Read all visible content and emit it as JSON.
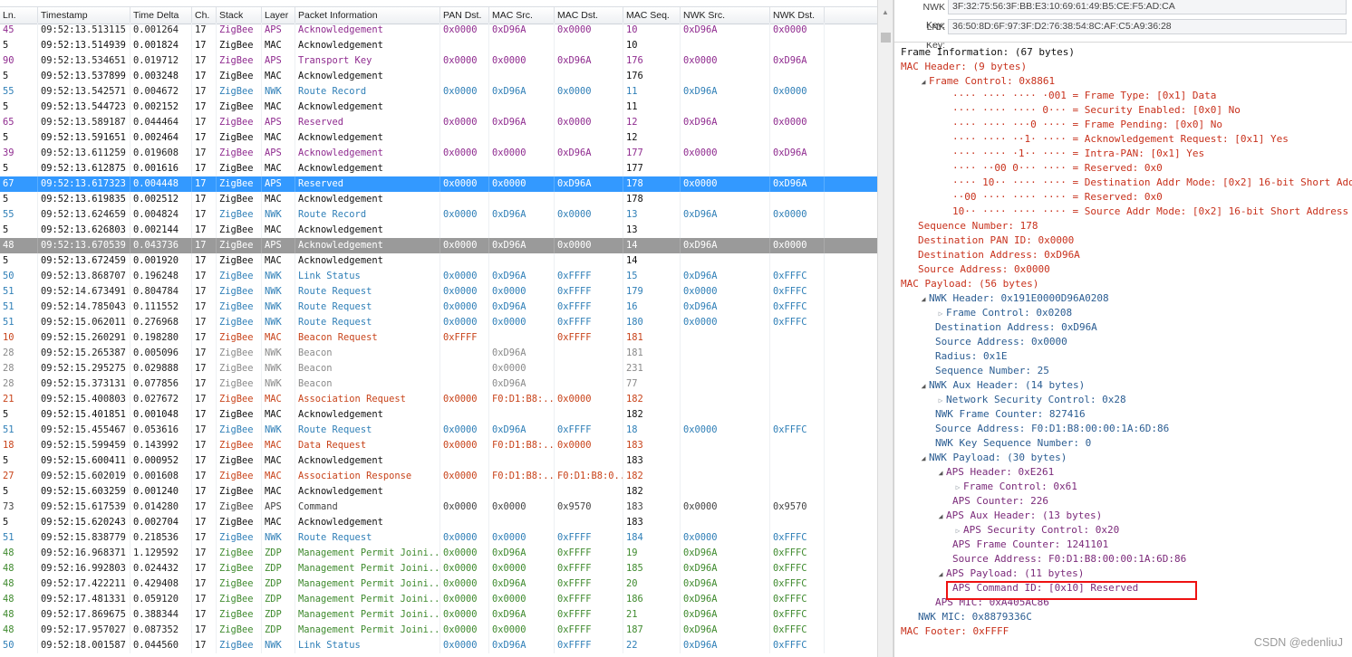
{
  "columns": [
    "Ln.",
    "Timestamp",
    "Time Delta",
    "Ch.",
    "Stack",
    "Layer",
    "Packet Information",
    "PAN Dst.",
    "MAC Src.",
    "MAC Dst.",
    "MAC Seq.",
    "NWK Src.",
    "NWK Dst."
  ],
  "packets": [
    {
      "ln": "45",
      "ts": "09:52:13.513115",
      "delta": "0.001264",
      "ch": "17",
      "stack": "ZigBee",
      "layer": "APS",
      "info": "Acknowledgement",
      "pan": "0x0000",
      "macsrc": "0xD96A",
      "macdst": "0x0000",
      "seq": "10",
      "nwksrc": "0xD96A",
      "nwkdst": "0x0000",
      "color": "#8f2b8f"
    },
    {
      "ln": "5",
      "ts": "09:52:13.514939",
      "delta": "0.001824",
      "ch": "17",
      "stack": "ZigBee",
      "layer": "MAC",
      "info": "Acknowledgement",
      "pan": "",
      "macsrc": "",
      "macdst": "",
      "seq": "10",
      "nwksrc": "",
      "nwkdst": "",
      "color": "#111111"
    },
    {
      "ln": "90",
      "ts": "09:52:13.534651",
      "delta": "0.019712",
      "ch": "17",
      "stack": "ZigBee",
      "layer": "APS",
      "info": "Transport Key",
      "pan": "0x0000",
      "macsrc": "0x0000",
      "macdst": "0xD96A",
      "seq": "176",
      "nwksrc": "0x0000",
      "nwkdst": "0xD96A",
      "color": "#8f2b8f"
    },
    {
      "ln": "5",
      "ts": "09:52:13.537899",
      "delta": "0.003248",
      "ch": "17",
      "stack": "ZigBee",
      "layer": "MAC",
      "info": "Acknowledgement",
      "pan": "",
      "macsrc": "",
      "macdst": "",
      "seq": "176",
      "nwksrc": "",
      "nwkdst": "",
      "color": "#111111"
    },
    {
      "ln": "55",
      "ts": "09:52:13.542571",
      "delta": "0.004672",
      "ch": "17",
      "stack": "ZigBee",
      "layer": "NWK",
      "info": "Route Record",
      "pan": "0x0000",
      "macsrc": "0xD96A",
      "macdst": "0x0000",
      "seq": "11",
      "nwksrc": "0xD96A",
      "nwkdst": "0x0000",
      "color": "#2f7fb7"
    },
    {
      "ln": "5",
      "ts": "09:52:13.544723",
      "delta": "0.002152",
      "ch": "17",
      "stack": "ZigBee",
      "layer": "MAC",
      "info": "Acknowledgement",
      "pan": "",
      "macsrc": "",
      "macdst": "",
      "seq": "11",
      "nwksrc": "",
      "nwkdst": "",
      "color": "#111111"
    },
    {
      "ln": "65",
      "ts": "09:52:13.589187",
      "delta": "0.044464",
      "ch": "17",
      "stack": "ZigBee",
      "layer": "APS",
      "info": "Reserved",
      "pan": "0x0000",
      "macsrc": "0xD96A",
      "macdst": "0x0000",
      "seq": "12",
      "nwksrc": "0xD96A",
      "nwkdst": "0x0000",
      "color": "#8f2b8f"
    },
    {
      "ln": "5",
      "ts": "09:52:13.591651",
      "delta": "0.002464",
      "ch": "17",
      "stack": "ZigBee",
      "layer": "MAC",
      "info": "Acknowledgement",
      "pan": "",
      "macsrc": "",
      "macdst": "",
      "seq": "12",
      "nwksrc": "",
      "nwkdst": "",
      "color": "#111111"
    },
    {
      "ln": "39",
      "ts": "09:52:13.611259",
      "delta": "0.019608",
      "ch": "17",
      "stack": "ZigBee",
      "layer": "APS",
      "info": "Acknowledgement",
      "pan": "0x0000",
      "macsrc": "0x0000",
      "macdst": "0xD96A",
      "seq": "177",
      "nwksrc": "0x0000",
      "nwkdst": "0xD96A",
      "color": "#8f2b8f"
    },
    {
      "ln": "5",
      "ts": "09:52:13.612875",
      "delta": "0.001616",
      "ch": "17",
      "stack": "ZigBee",
      "layer": "MAC",
      "info": "Acknowledgement",
      "pan": "",
      "macsrc": "",
      "macdst": "",
      "seq": "177",
      "nwksrc": "",
      "nwkdst": "",
      "color": "#111111"
    },
    {
      "ln": "67",
      "ts": "09:52:13.617323",
      "delta": "0.004448",
      "ch": "17",
      "stack": "ZigBee",
      "layer": "APS",
      "info": "Reserved",
      "pan": "0x0000",
      "macsrc": "0x0000",
      "macdst": "0xD96A",
      "seq": "178",
      "nwksrc": "0x0000",
      "nwkdst": "0xD96A",
      "color": "#8f2b8f",
      "selected": "primary"
    },
    {
      "ln": "5",
      "ts": "09:52:13.619835",
      "delta": "0.002512",
      "ch": "17",
      "stack": "ZigBee",
      "layer": "MAC",
      "info": "Acknowledgement",
      "pan": "",
      "macsrc": "",
      "macdst": "",
      "seq": "178",
      "nwksrc": "",
      "nwkdst": "",
      "color": "#111111"
    },
    {
      "ln": "55",
      "ts": "09:52:13.624659",
      "delta": "0.004824",
      "ch": "17",
      "stack": "ZigBee",
      "layer": "NWK",
      "info": "Route Record",
      "pan": "0x0000",
      "macsrc": "0xD96A",
      "macdst": "0x0000",
      "seq": "13",
      "nwksrc": "0xD96A",
      "nwkdst": "0x0000",
      "color": "#2f7fb7"
    },
    {
      "ln": "5",
      "ts": "09:52:13.626803",
      "delta": "0.002144",
      "ch": "17",
      "stack": "ZigBee",
      "layer": "MAC",
      "info": "Acknowledgement",
      "pan": "",
      "macsrc": "",
      "macdst": "",
      "seq": "13",
      "nwksrc": "",
      "nwkdst": "",
      "color": "#111111"
    },
    {
      "ln": "48",
      "ts": "09:52:13.670539",
      "delta": "0.043736",
      "ch": "17",
      "stack": "ZigBee",
      "layer": "APS",
      "info": "Acknowledgement",
      "pan": "0x0000",
      "macsrc": "0xD96A",
      "macdst": "0x0000",
      "seq": "14",
      "nwksrc": "0xD96A",
      "nwkdst": "0x0000",
      "color": "#8f2b8f",
      "selected": "secondary"
    },
    {
      "ln": "5",
      "ts": "09:52:13.672459",
      "delta": "0.001920",
      "ch": "17",
      "stack": "ZigBee",
      "layer": "MAC",
      "info": "Acknowledgement",
      "pan": "",
      "macsrc": "",
      "macdst": "",
      "seq": "14",
      "nwksrc": "",
      "nwkdst": "",
      "color": "#111111"
    },
    {
      "ln": "50",
      "ts": "09:52:13.868707",
      "delta": "0.196248",
      "ch": "17",
      "stack": "ZigBee",
      "layer": "NWK",
      "info": "Link Status",
      "pan": "0x0000",
      "macsrc": "0xD96A",
      "macdst": "0xFFFF",
      "seq": "15",
      "nwksrc": "0xD96A",
      "nwkdst": "0xFFFC",
      "color": "#2f7fb7"
    },
    {
      "ln": "51",
      "ts": "09:52:14.673491",
      "delta": "0.804784",
      "ch": "17",
      "stack": "ZigBee",
      "layer": "NWK",
      "info": "Route Request",
      "pan": "0x0000",
      "macsrc": "0x0000",
      "macdst": "0xFFFF",
      "seq": "179",
      "nwksrc": "0x0000",
      "nwkdst": "0xFFFC",
      "color": "#2f7fb7"
    },
    {
      "ln": "51",
      "ts": "09:52:14.785043",
      "delta": "0.111552",
      "ch": "17",
      "stack": "ZigBee",
      "layer": "NWK",
      "info": "Route Request",
      "pan": "0x0000",
      "macsrc": "0xD96A",
      "macdst": "0xFFFF",
      "seq": "16",
      "nwksrc": "0xD96A",
      "nwkdst": "0xFFFC",
      "color": "#2f7fb7"
    },
    {
      "ln": "51",
      "ts": "09:52:15.062011",
      "delta": "0.276968",
      "ch": "17",
      "stack": "ZigBee",
      "layer": "NWK",
      "info": "Route Request",
      "pan": "0x0000",
      "macsrc": "0x0000",
      "macdst": "0xFFFF",
      "seq": "180",
      "nwksrc": "0x0000",
      "nwkdst": "0xFFFC",
      "color": "#2f7fb7"
    },
    {
      "ln": "10",
      "ts": "09:52:15.260291",
      "delta": "0.198280",
      "ch": "17",
      "stack": "ZigBee",
      "layer": "MAC",
      "info": "Beacon Request",
      "pan": "0xFFFF",
      "macsrc": "",
      "macdst": "0xFFFF",
      "seq": "181",
      "nwksrc": "",
      "nwkdst": "",
      "color": "#c8431a"
    },
    {
      "ln": "28",
      "ts": "09:52:15.265387",
      "delta": "0.005096",
      "ch": "17",
      "stack": "ZigBee",
      "layer": "NWK",
      "info": "Beacon",
      "pan": "",
      "macsrc": "0xD96A",
      "macdst": "",
      "seq": "181",
      "nwksrc": "",
      "nwkdst": "",
      "color": "#8a8a8a"
    },
    {
      "ln": "28",
      "ts": "09:52:15.295275",
      "delta": "0.029888",
      "ch": "17",
      "stack": "ZigBee",
      "layer": "NWK",
      "info": "Beacon",
      "pan": "",
      "macsrc": "0x0000",
      "macdst": "",
      "seq": "231",
      "nwksrc": "",
      "nwkdst": "",
      "color": "#8a8a8a"
    },
    {
      "ln": "28",
      "ts": "09:52:15.373131",
      "delta": "0.077856",
      "ch": "17",
      "stack": "ZigBee",
      "layer": "NWK",
      "info": "Beacon",
      "pan": "",
      "macsrc": "0xD96A",
      "macdst": "",
      "seq": "77",
      "nwksrc": "",
      "nwkdst": "",
      "color": "#8a8a8a"
    },
    {
      "ln": "21",
      "ts": "09:52:15.400803",
      "delta": "0.027672",
      "ch": "17",
      "stack": "ZigBee",
      "layer": "MAC",
      "info": "Association Request",
      "pan": "0x0000",
      "macsrc": "F0:D1:B8:...",
      "macdst": "0x0000",
      "seq": "182",
      "nwksrc": "",
      "nwkdst": "",
      "color": "#c8431a"
    },
    {
      "ln": "5",
      "ts": "09:52:15.401851",
      "delta": "0.001048",
      "ch": "17",
      "stack": "ZigBee",
      "layer": "MAC",
      "info": "Acknowledgement",
      "pan": "",
      "macsrc": "",
      "macdst": "",
      "seq": "182",
      "nwksrc": "",
      "nwkdst": "",
      "color": "#111111"
    },
    {
      "ln": "51",
      "ts": "09:52:15.455467",
      "delta": "0.053616",
      "ch": "17",
      "stack": "ZigBee",
      "layer": "NWK",
      "info": "Route Request",
      "pan": "0x0000",
      "macsrc": "0xD96A",
      "macdst": "0xFFFF",
      "seq": "18",
      "nwksrc": "0x0000",
      "nwkdst": "0xFFFC",
      "color": "#2f7fb7"
    },
    {
      "ln": "18",
      "ts": "09:52:15.599459",
      "delta": "0.143992",
      "ch": "17",
      "stack": "ZigBee",
      "layer": "MAC",
      "info": "Data Request",
      "pan": "0x0000",
      "macsrc": "F0:D1:B8:...",
      "macdst": "0x0000",
      "seq": "183",
      "nwksrc": "",
      "nwkdst": "",
      "color": "#c8431a"
    },
    {
      "ln": "5",
      "ts": "09:52:15.600411",
      "delta": "0.000952",
      "ch": "17",
      "stack": "ZigBee",
      "layer": "MAC",
      "info": "Acknowledgement",
      "pan": "",
      "macsrc": "",
      "macdst": "",
      "seq": "183",
      "nwksrc": "",
      "nwkdst": "",
      "color": "#111111"
    },
    {
      "ln": "27",
      "ts": "09:52:15.602019",
      "delta": "0.001608",
      "ch": "17",
      "stack": "ZigBee",
      "layer": "MAC",
      "info": "Association Response",
      "pan": "0x0000",
      "macsrc": "F0:D1:B8:...",
      "macdst": "F0:D1:B8:0...",
      "seq": "182",
      "nwksrc": "",
      "nwkdst": "",
      "color": "#c8431a"
    },
    {
      "ln": "5",
      "ts": "09:52:15.603259",
      "delta": "0.001240",
      "ch": "17",
      "stack": "ZigBee",
      "layer": "MAC",
      "info": "Acknowledgement",
      "pan": "",
      "macsrc": "",
      "macdst": "",
      "seq": "182",
      "nwksrc": "",
      "nwkdst": "",
      "color": "#111111"
    },
    {
      "ln": "73",
      "ts": "09:52:15.617539",
      "delta": "0.014280",
      "ch": "17",
      "stack": "ZigBee",
      "layer": "APS",
      "info": "Command",
      "pan": "0x0000",
      "macsrc": "0x0000",
      "macdst": "0x9570",
      "seq": "183",
      "nwksrc": "0x0000",
      "nwkdst": "0x9570",
      "color": "#444444"
    },
    {
      "ln": "5",
      "ts": "09:52:15.620243",
      "delta": "0.002704",
      "ch": "17",
      "stack": "ZigBee",
      "layer": "MAC",
      "info": "Acknowledgement",
      "pan": "",
      "macsrc": "",
      "macdst": "",
      "seq": "183",
      "nwksrc": "",
      "nwkdst": "",
      "color": "#111111"
    },
    {
      "ln": "51",
      "ts": "09:52:15.838779",
      "delta": "0.218536",
      "ch": "17",
      "stack": "ZigBee",
      "layer": "NWK",
      "info": "Route Request",
      "pan": "0x0000",
      "macsrc": "0x0000",
      "macdst": "0xFFFF",
      "seq": "184",
      "nwksrc": "0x0000",
      "nwkdst": "0xFFFC",
      "color": "#2f7fb7"
    },
    {
      "ln": "48",
      "ts": "09:52:16.968371",
      "delta": "1.129592",
      "ch": "17",
      "stack": "ZigBee",
      "layer": "ZDP",
      "info": "Management Permit Joini...",
      "pan": "0x0000",
      "macsrc": "0xD96A",
      "macdst": "0xFFFF",
      "seq": "19",
      "nwksrc": "0xD96A",
      "nwkdst": "0xFFFC",
      "color": "#3f8a2e"
    },
    {
      "ln": "48",
      "ts": "09:52:16.992803",
      "delta": "0.024432",
      "ch": "17",
      "stack": "ZigBee",
      "layer": "ZDP",
      "info": "Management Permit Joini...",
      "pan": "0x0000",
      "macsrc": "0x0000",
      "macdst": "0xFFFF",
      "seq": "185",
      "nwksrc": "0xD96A",
      "nwkdst": "0xFFFC",
      "color": "#3f8a2e"
    },
    {
      "ln": "48",
      "ts": "09:52:17.422211",
      "delta": "0.429408",
      "ch": "17",
      "stack": "ZigBee",
      "layer": "ZDP",
      "info": "Management Permit Joini...",
      "pan": "0x0000",
      "macsrc": "0xD96A",
      "macdst": "0xFFFF",
      "seq": "20",
      "nwksrc": "0xD96A",
      "nwkdst": "0xFFFC",
      "color": "#3f8a2e"
    },
    {
      "ln": "48",
      "ts": "09:52:17.481331",
      "delta": "0.059120",
      "ch": "17",
      "stack": "ZigBee",
      "layer": "ZDP",
      "info": "Management Permit Joini...",
      "pan": "0x0000",
      "macsrc": "0x0000",
      "macdst": "0xFFFF",
      "seq": "186",
      "nwksrc": "0xD96A",
      "nwkdst": "0xFFFC",
      "color": "#3f8a2e"
    },
    {
      "ln": "48",
      "ts": "09:52:17.869675",
      "delta": "0.388344",
      "ch": "17",
      "stack": "ZigBee",
      "layer": "ZDP",
      "info": "Management Permit Joini...",
      "pan": "0x0000",
      "macsrc": "0xD96A",
      "macdst": "0xFFFF",
      "seq": "21",
      "nwksrc": "0xD96A",
      "nwkdst": "0xFFFC",
      "color": "#3f8a2e"
    },
    {
      "ln": "48",
      "ts": "09:52:17.957027",
      "delta": "0.087352",
      "ch": "17",
      "stack": "ZigBee",
      "layer": "ZDP",
      "info": "Management Permit Joini...",
      "pan": "0x0000",
      "macsrc": "0x0000",
      "macdst": "0xFFFF",
      "seq": "187",
      "nwksrc": "0xD96A",
      "nwkdst": "0xFFFC",
      "color": "#3f8a2e"
    },
    {
      "ln": "50",
      "ts": "09:52:18.001587",
      "delta": "0.044560",
      "ch": "17",
      "stack": "ZigBee",
      "layer": "NWK",
      "info": "Link Status",
      "pan": "0x0000",
      "macsrc": "0xD96A",
      "macdst": "0xFFFF",
      "seq": "22",
      "nwksrc": "0xD96A",
      "nwkdst": "0xFFFC",
      "color": "#2f7fb7"
    }
  ],
  "keys": [
    {
      "label": "NWK Key:",
      "value": "3F:32:75:56:3F:BB:E3:10:69:61:49:B5:CE:F5:AD:CA"
    },
    {
      "label": "LNK Key:",
      "value": "36:50:8D:6F:97:3F:D2:76:38:54:8C:AF:C5:A9:36:28"
    }
  ],
  "tree": [
    {
      "text": "Frame Information: (67 bytes)",
      "indent": 0,
      "toggle": "",
      "color": "black"
    },
    {
      "text": "MAC Header: (9 bytes)",
      "indent": 0,
      "toggle": "",
      "color": "red"
    },
    {
      "text": "Frame Control: 0x8861",
      "indent": 1,
      "toggle": "open",
      "color": "red"
    },
    {
      "text": "···· ···· ···· ·001 = Frame Type: [0x1] Data",
      "indent": 3,
      "toggle": "",
      "color": "red"
    },
    {
      "text": "···· ···· ···· 0··· = Security Enabled: [0x0] No",
      "indent": 3,
      "toggle": "",
      "color": "red"
    },
    {
      "text": "···· ···· ···0 ···· = Frame Pending: [0x0] No",
      "indent": 3,
      "toggle": "",
      "color": "red"
    },
    {
      "text": "···· ···· ··1· ···· = Acknowledgement Request: [0x1] Yes",
      "indent": 3,
      "toggle": "",
      "color": "red"
    },
    {
      "text": "···· ···· ·1·· ···· = Intra-PAN: [0x1] Yes",
      "indent": 3,
      "toggle": "",
      "color": "red"
    },
    {
      "text": "···· ··00 0··· ···· = Reserved: 0x0",
      "indent": 3,
      "toggle": "",
      "color": "red"
    },
    {
      "text": "···· 10·· ···· ···· = Destination Addr Mode: [0x2] 16-bit Short Address",
      "indent": 3,
      "toggle": "",
      "color": "red"
    },
    {
      "text": "··00 ···· ···· ···· = Reserved: 0x0",
      "indent": 3,
      "toggle": "",
      "color": "red"
    },
    {
      "text": "10·· ···· ···· ···· = Source Addr Mode: [0x2] 16-bit Short Address",
      "indent": 3,
      "toggle": "",
      "color": "red"
    },
    {
      "text": "Sequence Number: 178",
      "indent": 1,
      "toggle": "",
      "color": "red"
    },
    {
      "text": "Destination PAN ID: 0x0000",
      "indent": 1,
      "toggle": "",
      "color": "red"
    },
    {
      "text": "Destination Address: 0xD96A",
      "indent": 1,
      "toggle": "",
      "color": "red"
    },
    {
      "text": "Source Address: 0x0000",
      "indent": 1,
      "toggle": "",
      "color": "red"
    },
    {
      "text": "MAC Payload: (56 bytes)",
      "indent": 0,
      "toggle": "",
      "color": "red"
    },
    {
      "text": "NWK Header: 0x191E0000D96A0208",
      "indent": 1,
      "toggle": "open",
      "color": "blue"
    },
    {
      "text": "Frame Control: 0x0208",
      "indent": 2,
      "toggle": "closed",
      "color": "blue"
    },
    {
      "text": "Destination Address: 0xD96A",
      "indent": 2,
      "toggle": "",
      "color": "blue"
    },
    {
      "text": "Source Address: 0x0000",
      "indent": 2,
      "toggle": "",
      "color": "blue"
    },
    {
      "text": "Radius: 0x1E",
      "indent": 2,
      "toggle": "",
      "color": "blue"
    },
    {
      "text": "Sequence Number: 25",
      "indent": 2,
      "toggle": "",
      "color": "blue"
    },
    {
      "text": "NWK Aux Header: (14 bytes)",
      "indent": 1,
      "toggle": "open",
      "color": "blue"
    },
    {
      "text": "Network Security Control: 0x28",
      "indent": 2,
      "toggle": "closed",
      "color": "blue"
    },
    {
      "text": "NWK Frame Counter: 827416",
      "indent": 2,
      "toggle": "",
      "color": "blue"
    },
    {
      "text": "Source Address: F0:D1:B8:00:00:1A:6D:86",
      "indent": 2,
      "toggle": "",
      "color": "blue"
    },
    {
      "text": "NWK Key Sequence Number: 0",
      "indent": 2,
      "toggle": "",
      "color": "blue"
    },
    {
      "text": "NWK Payload: (30 bytes)",
      "indent": 1,
      "toggle": "open",
      "color": "blue"
    },
    {
      "text": "APS Header: 0xE261",
      "indent": 2,
      "toggle": "open",
      "color": "purple"
    },
    {
      "text": "Frame Control: 0x61",
      "indent": 3,
      "toggle": "closed",
      "color": "purple"
    },
    {
      "text": "APS Counter: 226",
      "indent": 3,
      "toggle": "",
      "color": "purple"
    },
    {
      "text": "APS Aux Header: (13 bytes)",
      "indent": 2,
      "toggle": "open",
      "color": "purple"
    },
    {
      "text": "APS Security Control: 0x20",
      "indent": 3,
      "toggle": "closed",
      "color": "purple"
    },
    {
      "text": "APS Frame Counter: 1241101",
      "indent": 3,
      "toggle": "",
      "color": "purple"
    },
    {
      "text": "Source Address: F0:D1:B8:00:00:1A:6D:86",
      "indent": 3,
      "toggle": "",
      "color": "purple"
    },
    {
      "text": "APS Payload: (11 bytes)",
      "indent": 2,
      "toggle": "open",
      "color": "purple"
    },
    {
      "text": "APS Command ID: [0x10] Reserved",
      "indent": 3,
      "toggle": "",
      "color": "purple"
    },
    {
      "text": "APS MIC: 0xA405AC86",
      "indent": 2,
      "toggle": "",
      "color": "purple"
    },
    {
      "text": "NWK MIC: 0x8879336C",
      "indent": 1,
      "toggle": "",
      "color": "blue"
    },
    {
      "text": "MAC Footer: 0xFFFF",
      "indent": 0,
      "toggle": "",
      "color": "red"
    }
  ],
  "watermark": "CSDN @edenliuJ"
}
